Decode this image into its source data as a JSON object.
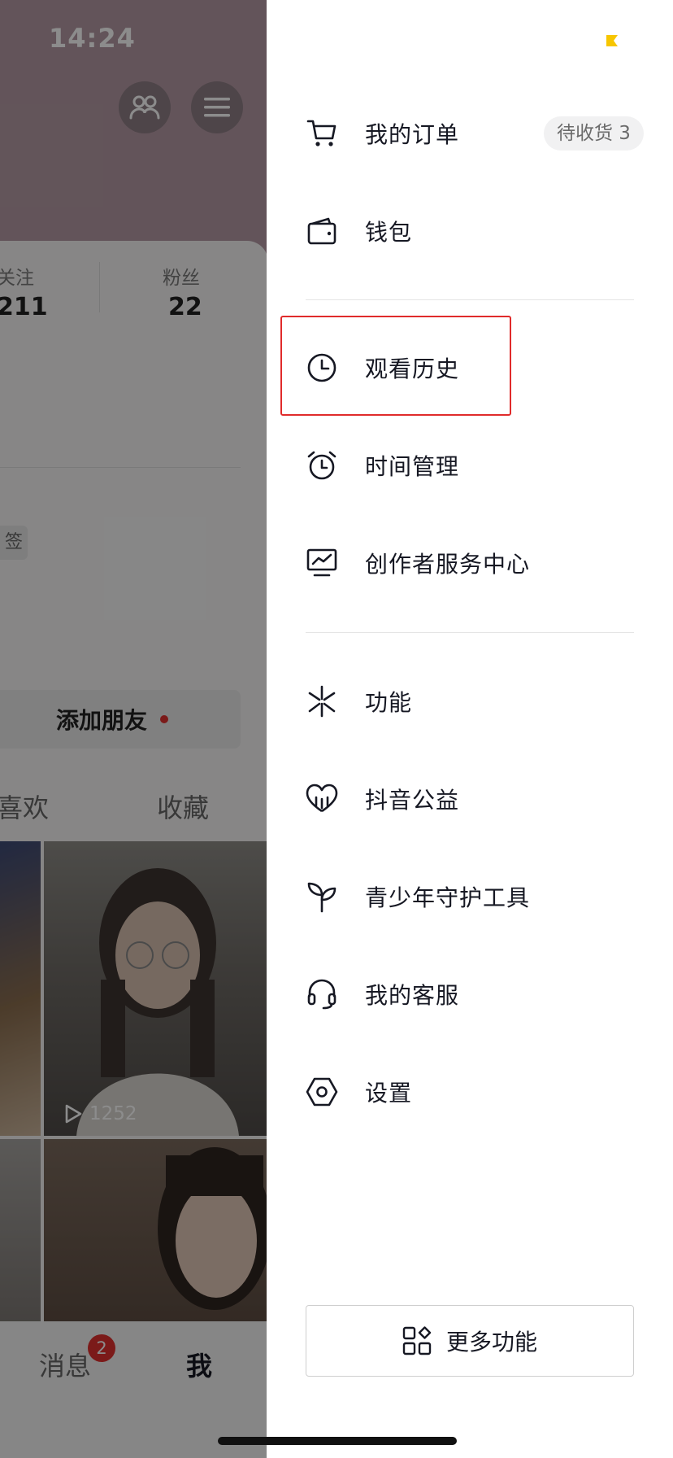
{
  "status_bar": {
    "time": "14:24"
  },
  "profile": {
    "following_label": "关注",
    "following_count": "211",
    "followers_label": "粉丝",
    "followers_count": "22",
    "tag_partial": "签",
    "add_friend_label": "添加朋友",
    "tabs": [
      "喜欢",
      "收藏"
    ],
    "video_play_count": "1252",
    "bottom_nav": {
      "messages_label": "消息",
      "messages_badge": "2",
      "me_label": "我"
    }
  },
  "drawer": {
    "menu_groups": [
      [
        {
          "label": "我的订单",
          "icon": "cart-icon",
          "badge": "待收货 3"
        },
        {
          "label": "钱包",
          "icon": "wallet-icon"
        }
      ],
      [
        {
          "label": "观看历史",
          "icon": "clock-icon",
          "highlighted": true
        },
        {
          "label": "时间管理",
          "icon": "alarm-clock-icon"
        },
        {
          "label": "创作者服务中心",
          "icon": "monitor-chart-icon"
        }
      ],
      [
        {
          "label": "功能",
          "icon": "sparkle-icon"
        },
        {
          "label": "抖音公益",
          "icon": "heart-charity-icon"
        },
        {
          "label": "青少年守护工具",
          "icon": "sprout-icon"
        },
        {
          "label": "我的客服",
          "icon": "headset-icon"
        },
        {
          "label": "设置",
          "icon": "hexagon-settings-icon"
        }
      ]
    ],
    "more_button_label": "更多功能",
    "more_button_icon": "apps-grid-icon"
  },
  "colors": {
    "highlight_border": "#e02b2b",
    "badge_red": "#e0302f",
    "corner_mark_yellow": "#f7c600"
  }
}
